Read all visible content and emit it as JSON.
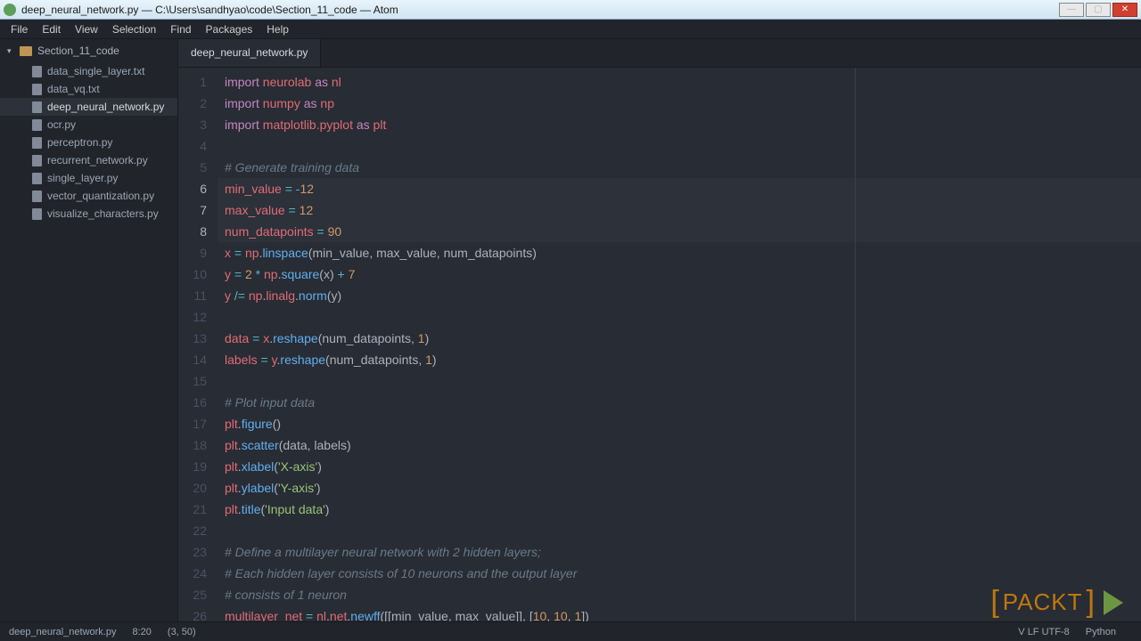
{
  "window": {
    "title": "deep_neural_network.py — C:\\Users\\sandhyao\\code\\Section_11_code — Atom"
  },
  "menu": [
    "File",
    "Edit",
    "View",
    "Selection",
    "Find",
    "Packages",
    "Help"
  ],
  "sidebar": {
    "folder": "Section_11_code",
    "files": [
      "data_single_layer.txt",
      "data_vq.txt",
      "deep_neural_network.py",
      "ocr.py",
      "perceptron.py",
      "recurrent_network.py",
      "single_layer.py",
      "vector_quantization.py",
      "visualize_characters.py"
    ],
    "active_index": 2
  },
  "tabs": {
    "active": "deep_neural_network.py"
  },
  "code": {
    "lines": [
      {
        "n": 1,
        "tokens": [
          [
            "import",
            "k-import"
          ],
          [
            " ",
            ""
          ],
          [
            "neurolab",
            "k-mod"
          ],
          [
            " ",
            ""
          ],
          [
            "as",
            "k-as"
          ],
          [
            " ",
            ""
          ],
          [
            "nl",
            "k-mod"
          ]
        ]
      },
      {
        "n": 2,
        "tokens": [
          [
            "import",
            "k-import"
          ],
          [
            " ",
            ""
          ],
          [
            "numpy",
            "k-mod"
          ],
          [
            " ",
            ""
          ],
          [
            "as",
            "k-as"
          ],
          [
            " ",
            ""
          ],
          [
            "np",
            "k-mod"
          ]
        ]
      },
      {
        "n": 3,
        "tokens": [
          [
            "import",
            "k-import"
          ],
          [
            " ",
            ""
          ],
          [
            "matplotlib.pyplot",
            "k-mod"
          ],
          [
            " ",
            ""
          ],
          [
            "as",
            "k-as"
          ],
          [
            " ",
            ""
          ],
          [
            "plt",
            "k-mod"
          ]
        ]
      },
      {
        "n": 4,
        "tokens": []
      },
      {
        "n": 5,
        "tokens": [
          [
            "# Generate training data",
            "k-comment"
          ]
        ]
      },
      {
        "n": 6,
        "hl": true,
        "tokens": [
          [
            "min_value",
            "k-var"
          ],
          [
            " ",
            ""
          ],
          [
            "=",
            "k-op"
          ],
          [
            " ",
            ""
          ],
          [
            "-",
            "k-op"
          ],
          [
            "12",
            "k-num"
          ]
        ]
      },
      {
        "n": 7,
        "hl": true,
        "tokens": [
          [
            "max_value",
            "k-var"
          ],
          [
            " ",
            ""
          ],
          [
            "=",
            "k-op"
          ],
          [
            " ",
            ""
          ],
          [
            "12",
            "k-num"
          ]
        ]
      },
      {
        "n": 8,
        "hl": true,
        "tokens": [
          [
            "num_datapoints",
            "k-var"
          ],
          [
            " ",
            ""
          ],
          [
            "=",
            "k-op"
          ],
          [
            " ",
            ""
          ],
          [
            "90",
            "k-num"
          ]
        ]
      },
      {
        "n": 9,
        "tokens": [
          [
            "x",
            "k-var"
          ],
          [
            " ",
            ""
          ],
          [
            "=",
            "k-op"
          ],
          [
            " ",
            ""
          ],
          [
            "np",
            "k-var"
          ],
          [
            ".",
            ""
          ],
          [
            "linspace",
            "k-func"
          ],
          [
            "(",
            "k-paren"
          ],
          [
            "min_value",
            ""
          ],
          [
            ", ",
            ""
          ],
          [
            "max_value",
            ""
          ],
          [
            ", ",
            ""
          ],
          [
            "num_datapoints",
            ""
          ],
          [
            ")",
            "k-paren"
          ]
        ]
      },
      {
        "n": 10,
        "tokens": [
          [
            "y",
            "k-var"
          ],
          [
            " ",
            ""
          ],
          [
            "=",
            "k-op"
          ],
          [
            " ",
            ""
          ],
          [
            "2",
            "k-num"
          ],
          [
            " ",
            ""
          ],
          [
            "*",
            "k-op"
          ],
          [
            " ",
            ""
          ],
          [
            "np",
            "k-var"
          ],
          [
            ".",
            ""
          ],
          [
            "square",
            "k-func"
          ],
          [
            "(",
            "k-paren"
          ],
          [
            "x",
            ""
          ],
          [
            ")",
            "k-paren"
          ],
          [
            " ",
            ""
          ],
          [
            "+",
            "k-op"
          ],
          [
            " ",
            ""
          ],
          [
            "7",
            "k-num"
          ]
        ]
      },
      {
        "n": 11,
        "tokens": [
          [
            "y",
            "k-var"
          ],
          [
            " ",
            ""
          ],
          [
            "/=",
            "k-op"
          ],
          [
            " ",
            ""
          ],
          [
            "np",
            "k-var"
          ],
          [
            ".",
            ""
          ],
          [
            "linalg",
            "k-var"
          ],
          [
            ".",
            ""
          ],
          [
            "norm",
            "k-func"
          ],
          [
            "(",
            "k-paren"
          ],
          [
            "y",
            ""
          ],
          [
            ")",
            "k-paren"
          ]
        ]
      },
      {
        "n": 12,
        "tokens": []
      },
      {
        "n": 13,
        "tokens": [
          [
            "data",
            "k-var"
          ],
          [
            " ",
            ""
          ],
          [
            "=",
            "k-op"
          ],
          [
            " ",
            ""
          ],
          [
            "x",
            "k-var"
          ],
          [
            ".",
            ""
          ],
          [
            "reshape",
            "k-func"
          ],
          [
            "(",
            "k-paren"
          ],
          [
            "num_datapoints",
            ""
          ],
          [
            ", ",
            ""
          ],
          [
            "1",
            "k-num"
          ],
          [
            ")",
            "k-paren"
          ]
        ]
      },
      {
        "n": 14,
        "tokens": [
          [
            "labels",
            "k-var"
          ],
          [
            " ",
            ""
          ],
          [
            "=",
            "k-op"
          ],
          [
            " ",
            ""
          ],
          [
            "y",
            "k-var"
          ],
          [
            ".",
            ""
          ],
          [
            "reshape",
            "k-func"
          ],
          [
            "(",
            "k-paren"
          ],
          [
            "num_datapoints",
            ""
          ],
          [
            ", ",
            ""
          ],
          [
            "1",
            "k-num"
          ],
          [
            ")",
            "k-paren"
          ]
        ]
      },
      {
        "n": 15,
        "tokens": []
      },
      {
        "n": 16,
        "tokens": [
          [
            "# Plot input data",
            "k-comment"
          ]
        ]
      },
      {
        "n": 17,
        "tokens": [
          [
            "plt",
            "k-var"
          ],
          [
            ".",
            ""
          ],
          [
            "figure",
            "k-func"
          ],
          [
            "(",
            "k-paren"
          ],
          [
            ")",
            "k-paren"
          ]
        ]
      },
      {
        "n": 18,
        "tokens": [
          [
            "plt",
            "k-var"
          ],
          [
            ".",
            ""
          ],
          [
            "scatter",
            "k-func"
          ],
          [
            "(",
            "k-paren"
          ],
          [
            "data",
            ""
          ],
          [
            ", ",
            ""
          ],
          [
            "labels",
            ""
          ],
          [
            ")",
            "k-paren"
          ]
        ]
      },
      {
        "n": 19,
        "tokens": [
          [
            "plt",
            "k-var"
          ],
          [
            ".",
            ""
          ],
          [
            "xlabel",
            "k-func"
          ],
          [
            "(",
            "k-paren"
          ],
          [
            "'X-axis'",
            "k-str"
          ],
          [
            ")",
            "k-paren"
          ]
        ]
      },
      {
        "n": 20,
        "tokens": [
          [
            "plt",
            "k-var"
          ],
          [
            ".",
            ""
          ],
          [
            "ylabel",
            "k-func"
          ],
          [
            "(",
            "k-paren"
          ],
          [
            "'Y-axis'",
            "k-str"
          ],
          [
            ")",
            "k-paren"
          ]
        ]
      },
      {
        "n": 21,
        "tokens": [
          [
            "plt",
            "k-var"
          ],
          [
            ".",
            ""
          ],
          [
            "title",
            "k-func"
          ],
          [
            "(",
            "k-paren"
          ],
          [
            "'Input data'",
            "k-str"
          ],
          [
            ")",
            "k-paren"
          ]
        ]
      },
      {
        "n": 22,
        "tokens": []
      },
      {
        "n": 23,
        "tokens": [
          [
            "# Define a multilayer neural network with 2 hidden layers;",
            "k-comment"
          ]
        ]
      },
      {
        "n": 24,
        "tokens": [
          [
            "# Each hidden layer consists of 10 neurons and the output layer",
            "k-comment"
          ]
        ]
      },
      {
        "n": 25,
        "tokens": [
          [
            "# consists of 1 neuron",
            "k-comment"
          ]
        ]
      },
      {
        "n": 26,
        "tokens": [
          [
            "multilayer_net",
            "k-var"
          ],
          [
            " ",
            ""
          ],
          [
            "=",
            "k-op"
          ],
          [
            " ",
            ""
          ],
          [
            "nl",
            "k-var"
          ],
          [
            ".",
            ""
          ],
          [
            "net",
            "k-var"
          ],
          [
            ".",
            ""
          ],
          [
            "newff",
            "k-func"
          ],
          [
            "(",
            "k-paren"
          ],
          [
            "[[",
            "k-paren"
          ],
          [
            "min_value",
            ""
          ],
          [
            ", ",
            ""
          ],
          [
            "max_value",
            ""
          ],
          [
            "]]",
            "k-paren"
          ],
          [
            ", ",
            ""
          ],
          [
            "[",
            "k-paren"
          ],
          [
            "10",
            "k-num"
          ],
          [
            ", ",
            ""
          ],
          [
            "10",
            "k-num"
          ],
          [
            ", ",
            ""
          ],
          [
            "1",
            "k-num"
          ],
          [
            "]",
            "k-paren"
          ],
          [
            ")",
            "k-paren"
          ]
        ]
      }
    ]
  },
  "status": {
    "file": "deep_neural_network.py",
    "time": "8:20",
    "cursor": "(3, 50)",
    "encoding": "V LF UTF-8",
    "lang": "Python"
  },
  "brand": "PACKT"
}
